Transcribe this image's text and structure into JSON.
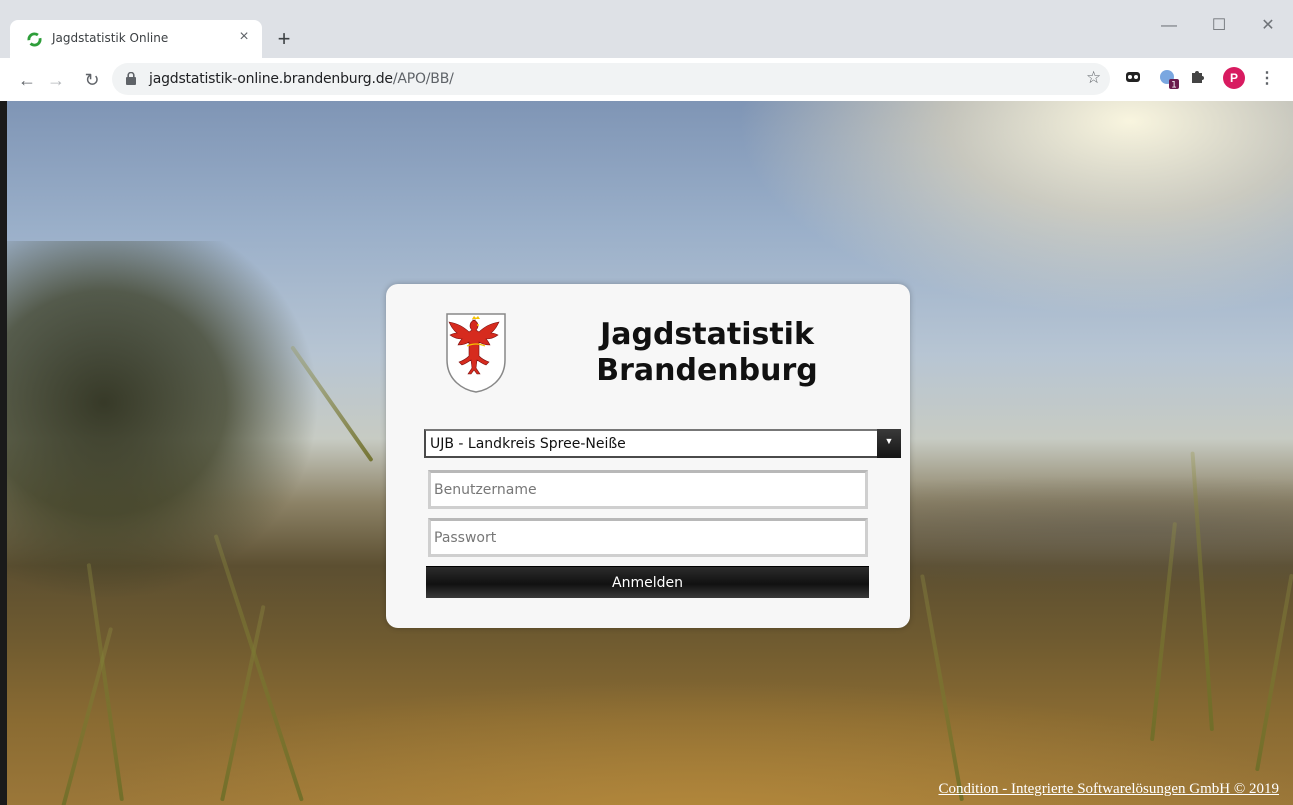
{
  "browser": {
    "tab_title": "Jagdstatistik Online",
    "tab_close": "×",
    "new_tab": "+",
    "url_domain": "jagdstatistik-online.brandenburg.de",
    "url_path": "/APO/BB/",
    "avatar_letter": "P",
    "extension_badge": "1"
  },
  "login": {
    "title_line1": "Jagdstatistik",
    "title_line2": "Brandenburg",
    "authority_selected": "UJB - Landkreis Spree-Neiße",
    "username_placeholder": "Benutzername",
    "password_placeholder": "Passwort",
    "submit_label": "Anmelden"
  },
  "footer": {
    "copyright": "Condition - Integrierte Softwarelösungen GmbH © 2019"
  },
  "colors": {
    "avatar": "#d81b60",
    "button": "#1a1a1a",
    "crest_eagle": "#d62b1e"
  }
}
